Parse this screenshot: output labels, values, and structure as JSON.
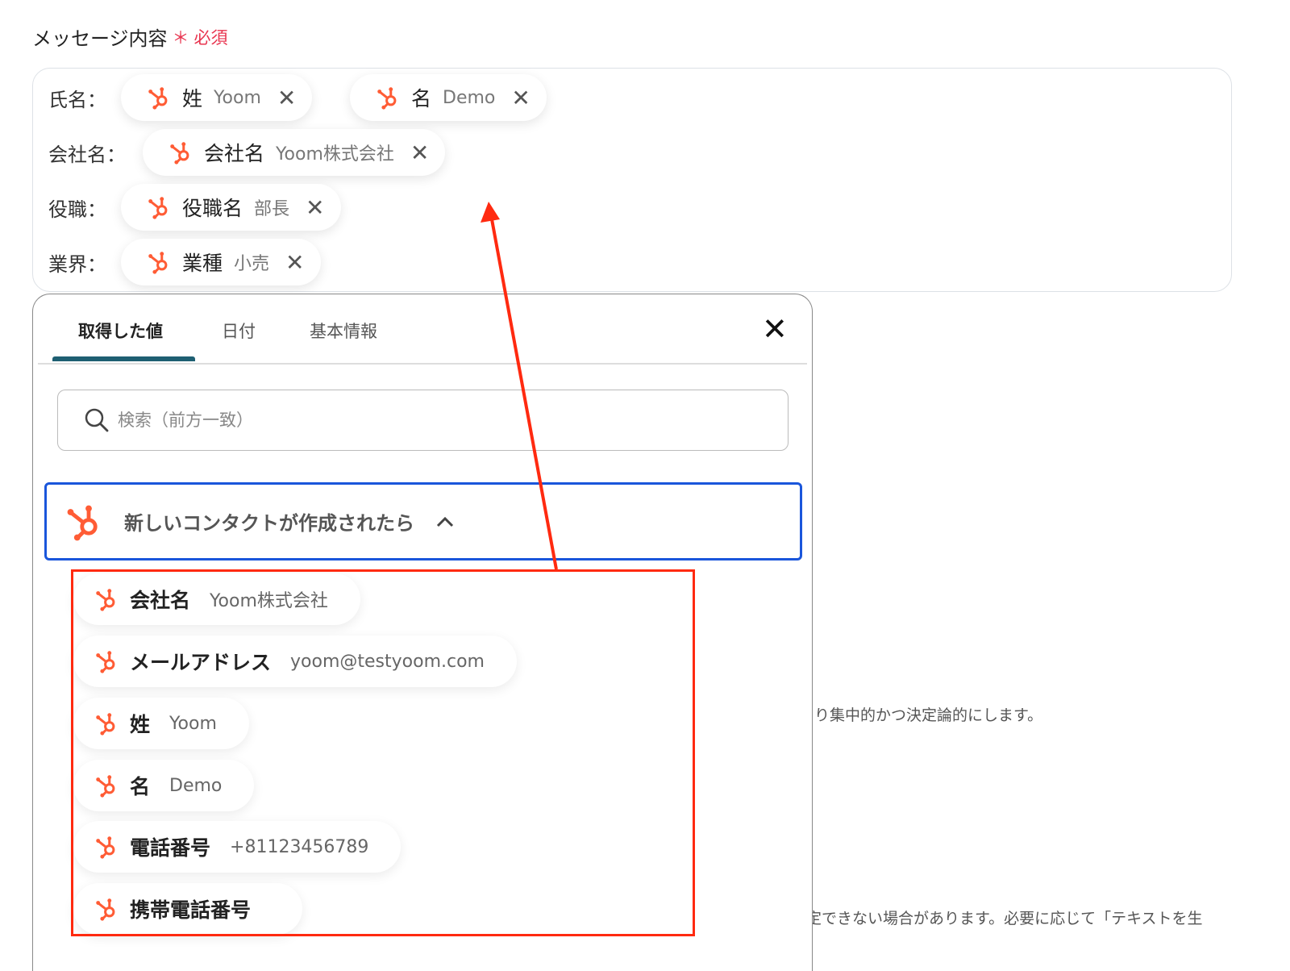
{
  "field": {
    "label": "メッセージ内容",
    "required_mark": "＊",
    "required_text": "必須"
  },
  "rows": [
    {
      "label": "氏名：",
      "chips": [
        {
          "key": "姓",
          "value": "Yoom"
        },
        {
          "key": "名",
          "value": "Demo"
        }
      ]
    },
    {
      "label": "会社名：",
      "chips": [
        {
          "key": "会社名",
          "value": "Yoom株式会社"
        }
      ]
    },
    {
      "label": "役職：",
      "chips": [
        {
          "key": "役職名",
          "value": "部長"
        }
      ]
    },
    {
      "label": "業界：",
      "chips": [
        {
          "key": "業種",
          "value": "小売"
        }
      ]
    }
  ],
  "background_texts": [
    "り集中的かつ決定論的にします。",
    "定できない場合があります。必要に応じて「テキストを生"
  ],
  "popup": {
    "tabs": [
      "取得した値",
      "日付",
      "基本情報"
    ],
    "active_tab": 0,
    "search_placeholder": "検索（前方一致）",
    "section_label": "新しいコンタクトが作成されたら",
    "items": [
      {
        "key": "会社名",
        "value": "Yoom株式会社"
      },
      {
        "key": "メールアドレス",
        "value": "yoom@testyoom.com"
      },
      {
        "key": "姓",
        "value": "Yoom"
      },
      {
        "key": "名",
        "value": "Demo"
      },
      {
        "key": "電話番号",
        "value": "+81123456789"
      },
      {
        "key": "携帯電話番号",
        "value": ""
      }
    ]
  },
  "colors": {
    "hubspot": "#ff5c35",
    "highlight": "#ff2a10",
    "accent_tab": "#1e5f72",
    "section_border": "#1a56db",
    "required": "#e8344f"
  }
}
